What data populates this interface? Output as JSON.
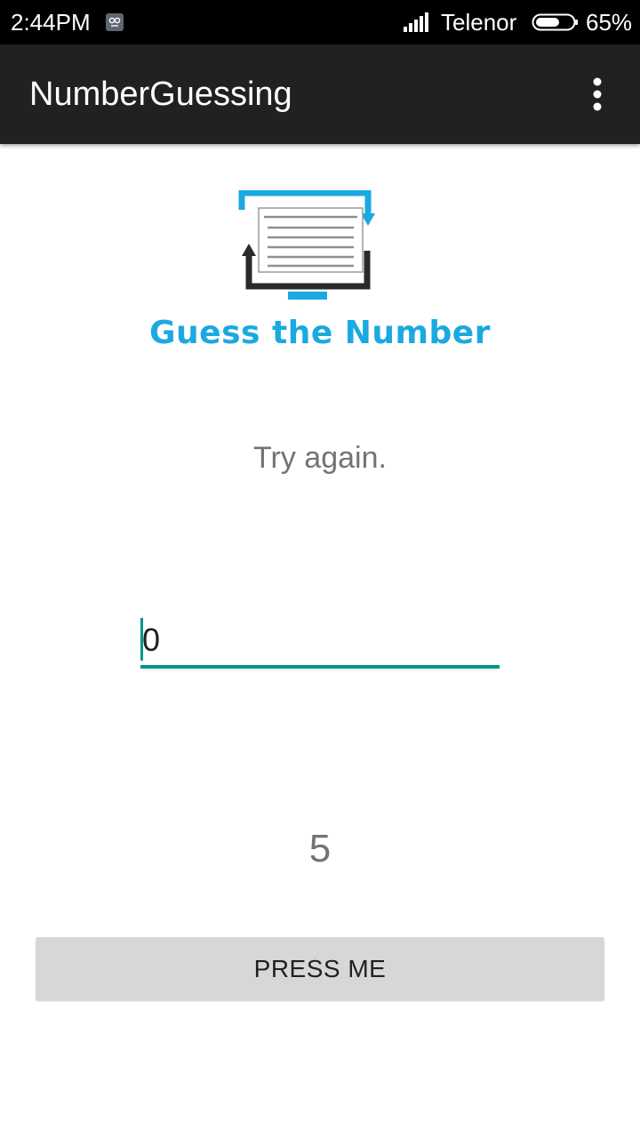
{
  "status_bar": {
    "time": "2:44PM",
    "notification_icon": "notification-icon",
    "signal_icon": "signal-icon",
    "carrier": "Telenor",
    "battery_icon": "battery-icon",
    "battery_level": 0.65,
    "battery_percent": "65%"
  },
  "app_bar": {
    "title": "NumberGuessing",
    "overflow_icon": "more-vert-icon"
  },
  "logo": {
    "icon": "guess-number-logo-icon",
    "text": "Guess the Number"
  },
  "main": {
    "hint": "Try again.",
    "guess_input_value": "0",
    "remaining_value": "5",
    "press_button_label": "PRESS ME"
  },
  "colors": {
    "accent": "#009688",
    "logo_blue": "#1aa9e1",
    "app_bar": "#212121",
    "status_bar": "#000000",
    "secondary_text": "#737373",
    "button_bg": "#d6d7d7"
  }
}
